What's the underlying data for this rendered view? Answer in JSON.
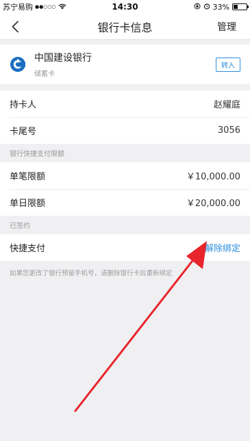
{
  "status_bar": {
    "carrier": "苏宁易购",
    "signal": "●●○○○",
    "time": "14:30",
    "battery_percent": "33%",
    "battery_level": 0.33
  },
  "nav": {
    "title": "银行卡信息",
    "manage_label": "管理"
  },
  "bank": {
    "name": "中国建设银行",
    "type": "储蓄卡",
    "transfer_label": "转入",
    "logo_icon": "ccb-logo-icon",
    "brand_color": "#1a6fc1"
  },
  "card_info": {
    "holder_label": "持卡人",
    "holder_value": "赵耀庭",
    "tail_label": "卡尾号",
    "tail_value": "3056"
  },
  "limits": {
    "section_title": "银行快捷支付限额",
    "single_label": "单笔限额",
    "single_value": "￥10,000.00",
    "daily_label": "单日限额",
    "daily_value": "￥20,000.00"
  },
  "signed": {
    "section_title": "已签约",
    "quick_pay_label": "快捷支付",
    "unbind_label": "解除绑定"
  },
  "footnote": "如果您更改了银行预留手机号，请删除银行卡后重新绑定",
  "colors": {
    "link": "#2a8ee0",
    "annotation_arrow": "#e8252c"
  }
}
